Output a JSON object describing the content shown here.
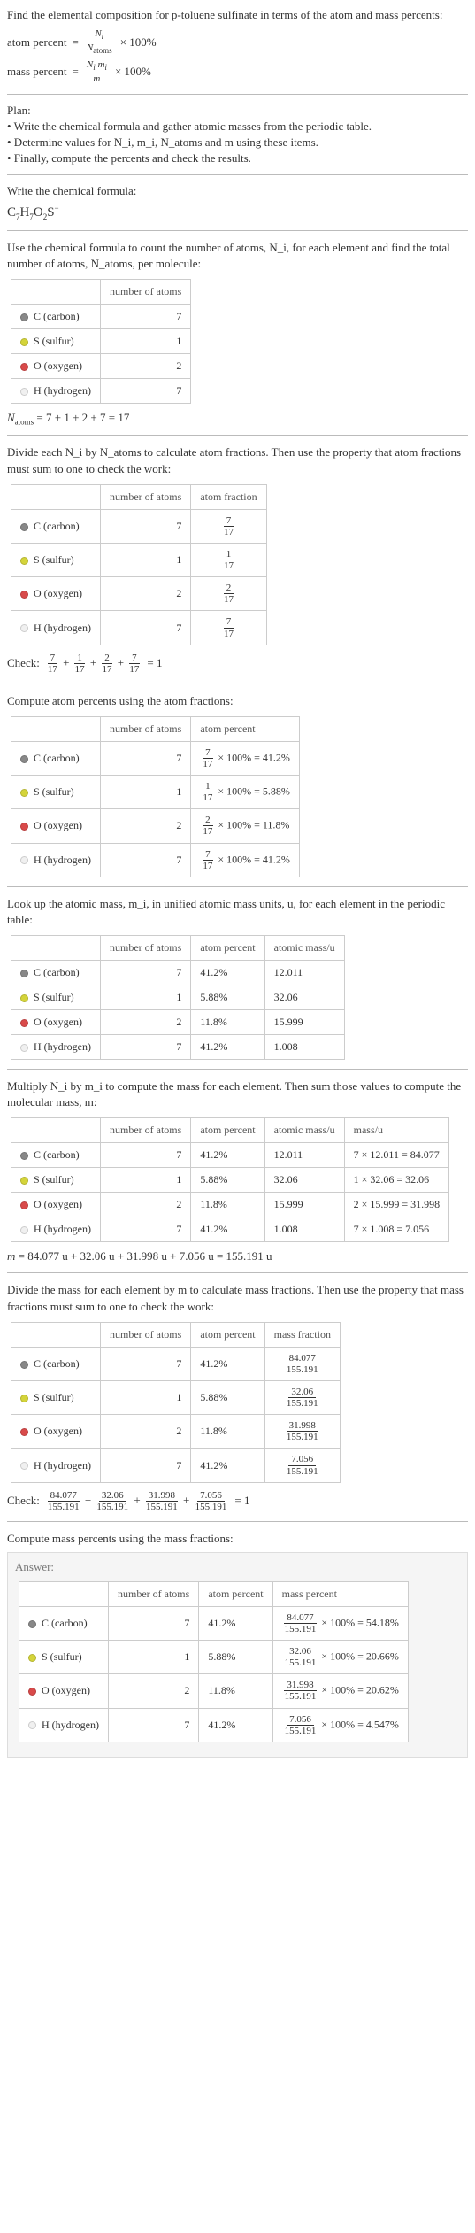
{
  "intro": "Find the elemental composition for p-toluene sulfinate in terms of the atom and mass percents:",
  "atom_percent_label": "atom percent",
  "mass_percent_label": "mass percent",
  "eq": "=",
  "times100": "× 100%",
  "Ni": "N",
  "i_sub": "i",
  "Natoms": "atoms",
  "mi": "m",
  "m": "m",
  "plan_title": "Plan:",
  "plan_items": [
    "• Write the chemical formula and gather atomic masses from the periodic table.",
    "• Determine values for N_i, m_i, N_atoms and m using these items.",
    "• Finally, compute the percents and check the results."
  ],
  "write_formula_label": "Write the chemical formula:",
  "chemical_formula_parts": [
    "C",
    "7",
    "H",
    "7",
    "O",
    "2",
    "S",
    "−"
  ],
  "use_formula_text": "Use the chemical formula to count the number of atoms, N_i, for each element and find the total number of atoms, N_atoms, per molecule:",
  "col_number_atoms": "number of atoms",
  "col_atom_fraction": "atom fraction",
  "col_atom_percent": "atom percent",
  "col_atomic_mass": "atomic mass/u",
  "col_mass": "mass/u",
  "col_mass_fraction": "mass fraction",
  "col_mass_percent": "mass percent",
  "elements": [
    {
      "sym": "C",
      "name": "carbon",
      "class": "c-carbon",
      "n": "7",
      "frac_num": "7",
      "frac_den": "17",
      "pct": "41.2%",
      "mass_u": "12.011",
      "mass_calc": "7 × 12.011 = 84.077",
      "massfrac_num": "84.077",
      "massfrac_den": "155.191",
      "masspct": "54.18%"
    },
    {
      "sym": "S",
      "name": "sulfur",
      "class": "c-sulfur",
      "n": "1",
      "frac_num": "1",
      "frac_den": "17",
      "pct": "5.88%",
      "mass_u": "32.06",
      "mass_calc": "1 × 32.06 = 32.06",
      "massfrac_num": "32.06",
      "massfrac_den": "155.191",
      "masspct": "20.66%"
    },
    {
      "sym": "O",
      "name": "oxygen",
      "class": "c-oxygen",
      "n": "2",
      "frac_num": "2",
      "frac_den": "17",
      "pct": "11.8%",
      "mass_u": "15.999",
      "mass_calc": "2 × 15.999 = 31.998",
      "massfrac_num": "31.998",
      "massfrac_den": "155.191",
      "masspct": "20.62%"
    },
    {
      "sym": "H",
      "name": "hydrogen",
      "class": "c-hydrogen",
      "n": "7",
      "frac_num": "7",
      "frac_den": "17",
      "pct": "41.2%",
      "mass_u": "1.008",
      "mass_calc": "7 × 1.008 = 7.056",
      "massfrac_num": "7.056",
      "massfrac_den": "155.191",
      "masspct": "4.547%"
    }
  ],
  "natoms_eq": "N_atoms = 7 + 1 + 2 + 7 = 17",
  "divide_text": "Divide each N_i by N_atoms to calculate atom fractions. Then use the property that atom fractions must sum to one to check the work:",
  "check_label": "Check:",
  "check_frac_sum": " = 1",
  "compute_atom_pct_text": "Compute atom percents using the atom fractions:",
  "lookup_text": "Look up the atomic mass, m_i, in unified atomic mass units, u, for each element in the periodic table:",
  "multiply_text": "Multiply N_i by m_i to compute the mass for each element. Then sum those values to compute the molecular mass, m:",
  "m_eq": "m = 84.077 u + 32.06 u + 31.998 u + 7.056 u = 155.191 u",
  "divide_mass_text": "Divide the mass for each element by m to calculate mass fractions. Then use the property that mass fractions must sum to one to check the work:",
  "compute_mass_pct_text": "Compute mass percents using the mass fractions:",
  "answer_label": "Answer:",
  "pct100": " × 100% = "
}
